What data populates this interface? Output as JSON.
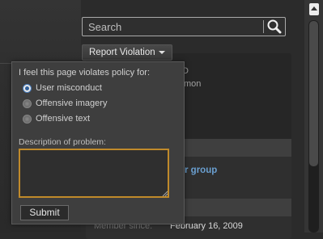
{
  "search": {
    "placeholder": "Search",
    "icon": "search-icon"
  },
  "report": {
    "button_label": "Report Violation",
    "icon": "chevron-down-icon"
  },
  "background": {
    "partial_text_1": "D",
    "partial_text_2": "mon",
    "group_link": "r group",
    "member_since_label": "Member since:",
    "member_since_value": "February 16, 2009"
  },
  "popup": {
    "title": "I feel this page violates policy for:",
    "options": [
      {
        "label": "User misconduct",
        "selected": true
      },
      {
        "label": "Offensive imagery",
        "selected": false
      },
      {
        "label": "Offensive text",
        "selected": false
      }
    ],
    "description_label": "Description of problem:",
    "description_value": "",
    "submit_label": "Submit"
  },
  "colors": {
    "accent_focus": "#c08a2a",
    "link": "#6a9fd0",
    "background": "#2b2b2b"
  }
}
